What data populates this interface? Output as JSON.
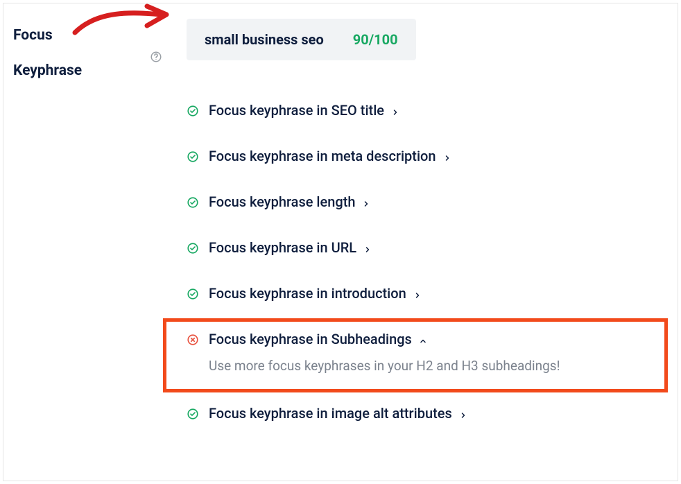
{
  "section_label_line1": "Focus",
  "section_label_line2": "Keyphrase",
  "keyphrase": {
    "text": "small business seo",
    "score": "90/100"
  },
  "checks": [
    {
      "status": "pass",
      "title": "Focus keyphrase in SEO title",
      "expanded": false
    },
    {
      "status": "pass",
      "title": "Focus keyphrase in meta description",
      "expanded": false
    },
    {
      "status": "pass",
      "title": "Focus keyphrase length",
      "expanded": false
    },
    {
      "status": "pass",
      "title": "Focus keyphrase in URL",
      "expanded": false
    },
    {
      "status": "pass",
      "title": "Focus keyphrase in introduction",
      "expanded": false
    },
    {
      "status": "fail",
      "title": "Focus keyphrase in Subheadings",
      "expanded": true,
      "highlighted": true,
      "desc": "Use more focus keyphrases in your H2 and H3 subheadings!"
    },
    {
      "status": "pass",
      "title": "Focus keyphrase in image alt attributes",
      "expanded": false
    }
  ],
  "colors": {
    "pass": "#18a862",
    "fail": "#e8523f"
  }
}
